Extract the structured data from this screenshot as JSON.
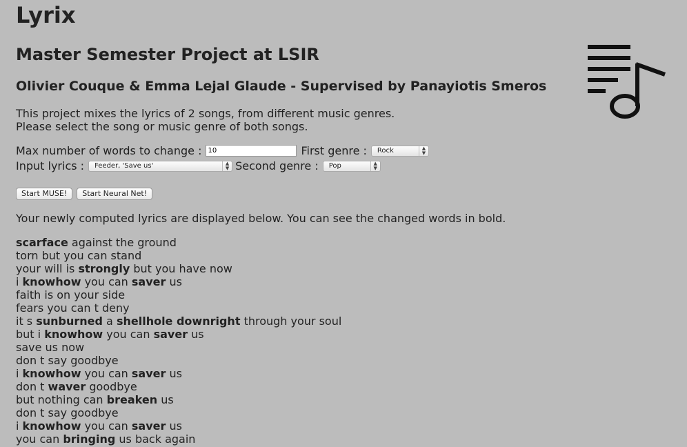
{
  "app": {
    "title": "Lyrix",
    "subtitle": "Master Semester Project at LSIR",
    "authors": "Olivier Couque & Emma Lejal Glaude - Supervised by Panayiotis Smeros"
  },
  "intro": {
    "line1": "This project mixes the lyrics of 2 songs, from different music genres.",
    "line2": "Please select the song or music genre of both songs."
  },
  "form": {
    "max_words_label": "Max number of words to change :",
    "max_words_value": "10",
    "first_genre_label": "First genre :",
    "first_genre_value": "Rock",
    "input_lyrics_label": "Input lyrics :",
    "input_lyrics_value": "Feeder, 'Save us'",
    "second_genre_label": "Second genre :",
    "second_genre_value": "Pop"
  },
  "buttons": {
    "start_muse": "Start MUSE!",
    "start_neural": "Start Neural Net!"
  },
  "result_note": "Your newly computed lyrics are displayed below. You can see the changed words in bold.",
  "lyrics": [
    [
      {
        "t": "scarface",
        "b": true
      },
      {
        "t": " against the ground",
        "b": false
      }
    ],
    [
      {
        "t": "torn but you can stand",
        "b": false
      }
    ],
    [
      {
        "t": "your will is ",
        "b": false
      },
      {
        "t": "strongly",
        "b": true
      },
      {
        "t": " but you have now",
        "b": false
      }
    ],
    [
      {
        "t": "i ",
        "b": false
      },
      {
        "t": "knowhow",
        "b": true
      },
      {
        "t": " you can ",
        "b": false
      },
      {
        "t": "saver",
        "b": true
      },
      {
        "t": " us",
        "b": false
      }
    ],
    [
      {
        "t": "faith is on your side",
        "b": false
      }
    ],
    [
      {
        "t": "fears you can t deny",
        "b": false
      }
    ],
    [
      {
        "t": "it s ",
        "b": false
      },
      {
        "t": "sunburned",
        "b": true
      },
      {
        "t": " a ",
        "b": false
      },
      {
        "t": "shellhole downright",
        "b": true
      },
      {
        "t": " through your soul",
        "b": false
      }
    ],
    [
      {
        "t": "but i ",
        "b": false
      },
      {
        "t": "knowhow",
        "b": true
      },
      {
        "t": " you can ",
        "b": false
      },
      {
        "t": "saver",
        "b": true
      },
      {
        "t": " us",
        "b": false
      }
    ],
    [
      {
        "t": "save us now",
        "b": false
      }
    ],
    [
      {
        "t": "don t say goodbye",
        "b": false
      }
    ],
    [
      {
        "t": "i ",
        "b": false
      },
      {
        "t": "knowhow",
        "b": true
      },
      {
        "t": " you can ",
        "b": false
      },
      {
        "t": "saver",
        "b": true
      },
      {
        "t": " us",
        "b": false
      }
    ],
    [
      {
        "t": "don t ",
        "b": false
      },
      {
        "t": "waver",
        "b": true
      },
      {
        "t": " goodbye",
        "b": false
      }
    ],
    [
      {
        "t": "but nothing can ",
        "b": false
      },
      {
        "t": "breaken",
        "b": true
      },
      {
        "t": " us",
        "b": false
      }
    ],
    [
      {
        "t": "don t say goodbye",
        "b": false
      }
    ],
    [
      {
        "t": "i ",
        "b": false
      },
      {
        "t": "knowhow",
        "b": true
      },
      {
        "t": " you can ",
        "b": false
      },
      {
        "t": "saver",
        "b": true
      },
      {
        "t": " us",
        "b": false
      }
    ],
    [
      {
        "t": "you can ",
        "b": false
      },
      {
        "t": "bringing",
        "b": true
      },
      {
        "t": " us back again",
        "b": false
      }
    ]
  ],
  "icons": {
    "logo": "playlist-music-icon",
    "select_arrow": "chevron-up-down-icon"
  },
  "colors": {
    "background": "#bcbcbc",
    "text": "#222222"
  }
}
